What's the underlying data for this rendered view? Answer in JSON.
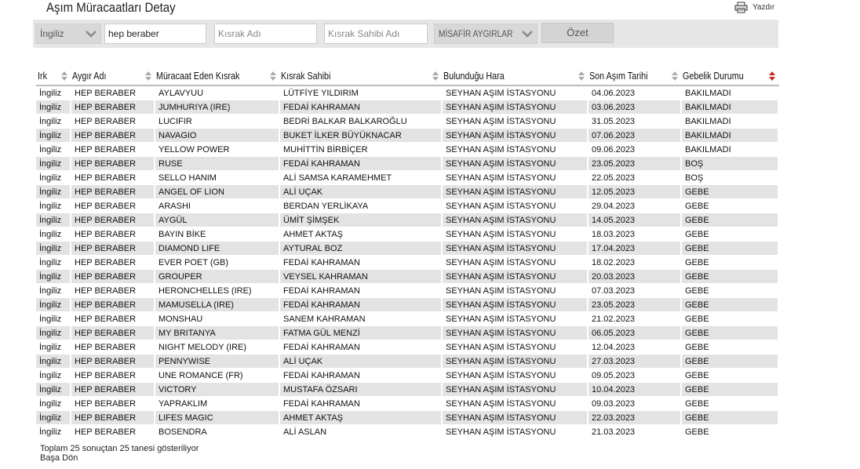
{
  "page": {
    "title": "Aşım Müracaatları Detay",
    "print_label": "Yazdır"
  },
  "filters": {
    "breed_selected": "İngiliz",
    "stallion_value": "hep beraber",
    "mare_placeholder": "Kısrak Adı",
    "mare_owner_placeholder": "Kısrak Sahibi Adı",
    "guest_stallions_label": "MİSAFİR AYGIRLAR",
    "summary_button": "Özet"
  },
  "table": {
    "headers": [
      "Irk",
      "Aygır Adı",
      "Müracaat Eden Kısrak",
      "Kısrak Sahibi",
      "Bulunduğu Hara",
      "Son Aşım Tarihi",
      "Gebelik Durumu"
    ],
    "rows": [
      [
        "İngiliz",
        "HEP BERABER",
        "AYLAVYUU",
        "LÜTFİYE YILDIRIM",
        "SEYHAN AŞIM İSTASYONU",
        "04.06.2023",
        "BAKILMADI"
      ],
      [
        "İngiliz",
        "HEP BERABER",
        "JUMHURIYA (IRE)",
        "FEDAİ KAHRAMAN",
        "SEYHAN AŞIM İSTASYONU",
        "03.06.2023",
        "BAKILMADI"
      ],
      [
        "İngiliz",
        "HEP BERABER",
        "LUCIFIR",
        "BEDRİ BALKAR BALKAROĞLU",
        "SEYHAN AŞIM İSTASYONU",
        "31.05.2023",
        "BAKILMADI"
      ],
      [
        "İngiliz",
        "HEP BERABER",
        "NAVAGIO",
        "BUKET İLKER BÜYÜKNACAR",
        "SEYHAN AŞIM İSTASYONU",
        "07.06.2023",
        "BAKILMADI"
      ],
      [
        "İngiliz",
        "HEP BERABER",
        "YELLOW POWER",
        "MUHİTTİN BİRBİÇER",
        "SEYHAN AŞIM İSTASYONU",
        "09.06.2023",
        "BAKILMADI"
      ],
      [
        "İngiliz",
        "HEP BERABER",
        "RUSE",
        "FEDAİ KAHRAMAN",
        "SEYHAN AŞIM İSTASYONU",
        "23.05.2023",
        "BOŞ"
      ],
      [
        "İngiliz",
        "HEP BERABER",
        "SELLO HANIM",
        "ALİ SAMSA KARAMEHMET",
        "SEYHAN AŞIM İSTASYONU",
        "22.05.2023",
        "BOŞ"
      ],
      [
        "İngiliz",
        "HEP BERABER",
        "ANGEL OF LION",
        "ALİ UÇAK",
        "SEYHAN AŞIM İSTASYONU",
        "12.05.2023",
        "GEBE"
      ],
      [
        "İngiliz",
        "HEP BERABER",
        "ARASHI",
        "BERDAN YERLİKAYA",
        "SEYHAN AŞIM İSTASYONU",
        "29.04.2023",
        "GEBE"
      ],
      [
        "İngiliz",
        "HEP BERABER",
        "AYGÜL",
        "ÜMİT ŞİMŞEK",
        "SEYHAN AŞIM İSTASYONU",
        "14.05.2023",
        "GEBE"
      ],
      [
        "İngiliz",
        "HEP BERABER",
        "BAYIN BİKE",
        "AHMET AKTAŞ",
        "SEYHAN AŞIM İSTASYONU",
        "18.03.2023",
        "GEBE"
      ],
      [
        "İngiliz",
        "HEP BERABER",
        "DIAMOND LIFE",
        "AYTURAL BOZ",
        "SEYHAN AŞIM İSTASYONU",
        "17.04.2023",
        "GEBE"
      ],
      [
        "İngiliz",
        "HEP BERABER",
        "EVER POET (GB)",
        "FEDAİ KAHRAMAN",
        "SEYHAN AŞIM İSTASYONU",
        "18.02.2023",
        "GEBE"
      ],
      [
        "İngiliz",
        "HEP BERABER",
        "GROUPER",
        "VEYSEL KAHRAMAN",
        "SEYHAN AŞIM İSTASYONU",
        "20.03.2023",
        "GEBE"
      ],
      [
        "İngiliz",
        "HEP BERABER",
        "HERONCHELLES (IRE)",
        "FEDAİ KAHRAMAN",
        "SEYHAN AŞIM İSTASYONU",
        "07.03.2023",
        "GEBE"
      ],
      [
        "İngiliz",
        "HEP BERABER",
        "MAMUSELLA (IRE)",
        "FEDAİ KAHRAMAN",
        "SEYHAN AŞIM İSTASYONU",
        "23.05.2023",
        "GEBE"
      ],
      [
        "İngiliz",
        "HEP BERABER",
        "MONSHAU",
        "SANEM KAHRAMAN",
        "SEYHAN AŞIM İSTASYONU",
        "21.02.2023",
        "GEBE"
      ],
      [
        "İngiliz",
        "HEP BERABER",
        "MY BRITANYA",
        "FATMA GÜL MENZİ",
        "SEYHAN AŞIM İSTASYONU",
        "06.05.2023",
        "GEBE"
      ],
      [
        "İngiliz",
        "HEP BERABER",
        "NIGHT MELODY (IRE)",
        "FEDAİ KAHRAMAN",
        "SEYHAN AŞIM İSTASYONU",
        "12.04.2023",
        "GEBE"
      ],
      [
        "İngiliz",
        "HEP BERABER",
        "PENNYWISE",
        "ALİ UÇAK",
        "SEYHAN AŞIM İSTASYONU",
        "27.03.2023",
        "GEBE"
      ],
      [
        "İngiliz",
        "HEP BERABER",
        "UNE ROMANCE (FR)",
        "FEDAİ KAHRAMAN",
        "SEYHAN AŞIM İSTASYONU",
        "09.05.2023",
        "GEBE"
      ],
      [
        "İngiliz",
        "HEP BERABER",
        "VICTORY",
        "MUSTAFA ÖZSARI",
        "SEYHAN AŞIM İSTASYONU",
        "10.04.2023",
        "GEBE"
      ],
      [
        "İngiliz",
        "HEP BERABER",
        "YAPRAKLIM",
        "FEDAİ KAHRAMAN",
        "SEYHAN AŞIM İSTASYONU",
        "09.03.2023",
        "GEBE"
      ],
      [
        "İngiliz",
        "HEP BERABER",
        "LIFES MAGIC",
        "AHMET AKTAŞ",
        "SEYHAN AŞIM İSTASYONU",
        "22.03.2023",
        "GEBE"
      ],
      [
        "İngiliz",
        "HEP BERABER",
        "BOSENDRA",
        "ALİ ASLAN",
        "SEYHAN AŞIM İSTASYONU",
        "21.03.2023",
        "GEBE"
      ]
    ]
  },
  "footer": {
    "summary": "Toplam 25 sonuçtan 25 tanesi gösteriliyor",
    "back_to_top": "Başa Dön"
  },
  "colors": {
    "row_alt": "#e3e3e3",
    "sort_active": "#cc2222",
    "sort_inactive": "#aaaaaa"
  },
  "icons": {
    "print": "printer-icon",
    "dropdown": "chevron-down-icon",
    "sort": "sort-arrows-icon"
  }
}
